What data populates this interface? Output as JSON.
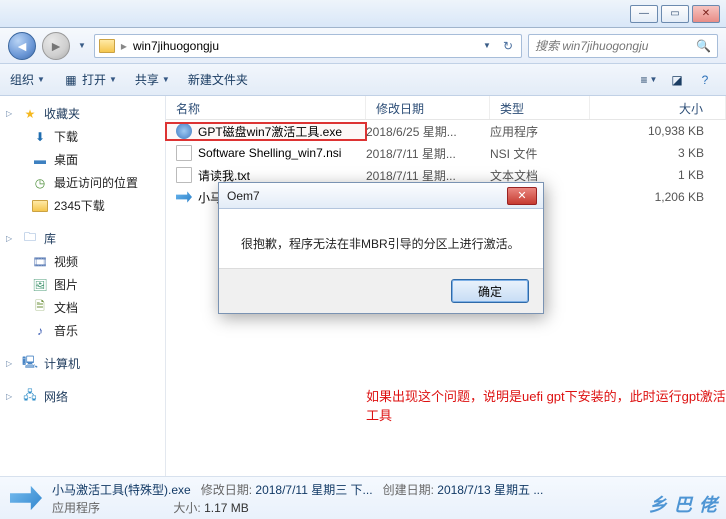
{
  "address": {
    "folder": "win7jihuogongju",
    "search_placeholder": "搜索 win7jihuogongju"
  },
  "toolbar": {
    "organize": "组织",
    "open": "打开",
    "share": "共享",
    "new_folder": "新建文件夹"
  },
  "columns": {
    "name": "名称",
    "date": "修改日期",
    "type": "类型",
    "size": "大小"
  },
  "files": [
    {
      "name": "GPT磁盘win7激活工具.exe",
      "date": "2018/6/25 星期...",
      "type": "应用程序",
      "size": "10,938 KB"
    },
    {
      "name": "Software Shelling_win7.nsi",
      "date": "2018/7/11 星期...",
      "type": "NSI 文件",
      "size": "3 KB"
    },
    {
      "name": "请读我.txt",
      "date": "2018/7/11 星期...",
      "type": "文本文档",
      "size": "1 KB"
    },
    {
      "name": "小马...",
      "date": "",
      "type": "",
      "size": "1,206 KB"
    }
  ],
  "sidebar": {
    "fav": "收藏夹",
    "fav_items": {
      "download": "下载",
      "desktop": "桌面",
      "recent": "最近访问的位置",
      "dl2345": "2345下载"
    },
    "lib": "库",
    "lib_items": {
      "video": "视频",
      "picture": "图片",
      "document": "文档",
      "music": "音乐"
    },
    "computer": "计算机",
    "network": "网络"
  },
  "dialog": {
    "title": "Oem7",
    "body": "很抱歉，程序无法在非MBR引导的分区上进行激活。",
    "ok": "确定"
  },
  "note": "如果出现这个问题，说明是uefi gpt下安装的，此时运行gpt激活工具",
  "details": {
    "filename": "小马激活工具(特殊型).exe",
    "type_label": "应用程序",
    "mod_label": "修改日期:",
    "mod": "2018/7/11 星期三 下...",
    "size_label": "大小:",
    "size": "1.17 MB",
    "create_label": "创建日期:",
    "create": "2018/7/13 星期五 ..."
  },
  "watermark": "乡 巴 佬"
}
